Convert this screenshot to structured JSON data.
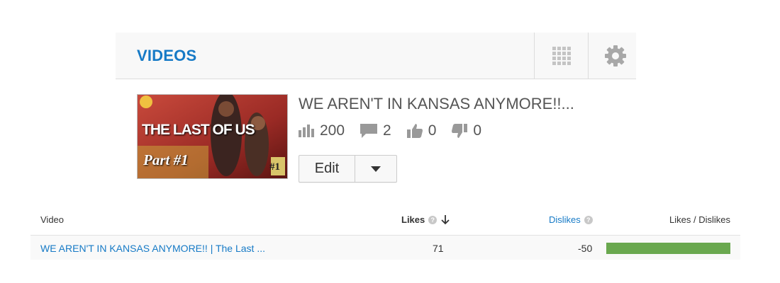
{
  "card": {
    "title": "VIDEOS",
    "icons": {
      "grid": "grid-view-icon",
      "settings": "gear-icon"
    }
  },
  "video": {
    "thumbnail_text": {
      "title": "THE LAST OF US",
      "part": "Part #1",
      "number": "#1"
    },
    "title": "WE AREN'T IN KANSAS ANYMORE!!...",
    "views": "200",
    "comments": "2",
    "likes": "0",
    "dislikes": "0",
    "edit_label": "Edit"
  },
  "table": {
    "headers": {
      "video": "Video",
      "likes": "Likes",
      "dislikes": "Dislikes",
      "ratio": "Likes / Dislikes"
    },
    "rows": [
      {
        "video": "WE AREN'T IN KANSAS ANYMORE!! | The Last ...",
        "likes": "71",
        "dislikes": "-50",
        "likes_fraction": 1.0
      }
    ]
  },
  "colors": {
    "accent": "#167ac6",
    "bar": "#6aa84f"
  }
}
